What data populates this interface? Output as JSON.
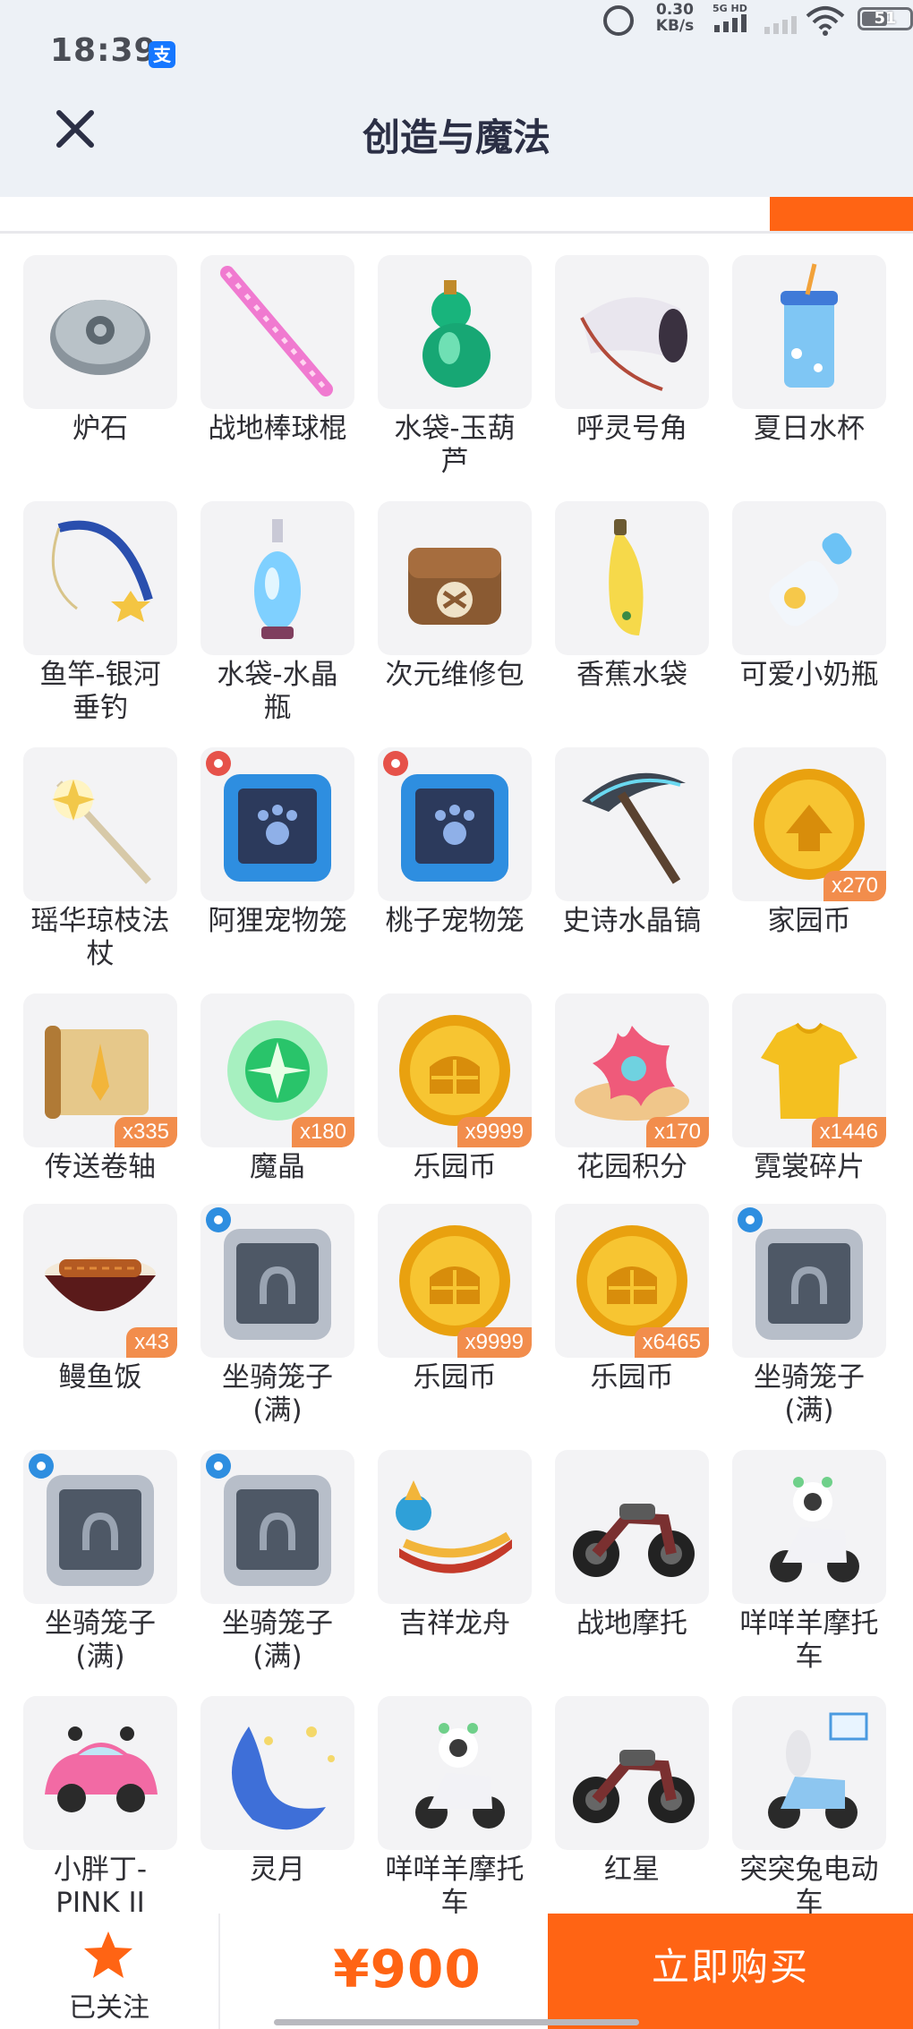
{
  "status_bar": {
    "time": "18:39",
    "app_badge": "支",
    "net_speed_value": "0.30",
    "net_speed_unit": "KB/s",
    "network_label": "5G HD",
    "battery": "51"
  },
  "header": {
    "title": "创造与魔法"
  },
  "items": [
    {
      "name": "炉石",
      "icon": "hearthstone-icon"
    },
    {
      "name": "战地棒球棍",
      "icon": "baseball-bat-icon"
    },
    {
      "name": "水袋-玉葫芦",
      "icon": "jade-gourd-icon"
    },
    {
      "name": "呼灵号角",
      "icon": "horn-icon"
    },
    {
      "name": "夏日水杯",
      "icon": "summer-cup-icon"
    },
    {
      "name": "鱼竿-银河垂钓",
      "icon": "fishing-rod-icon"
    },
    {
      "name": "水袋-水晶瓶",
      "icon": "crystal-bottle-icon"
    },
    {
      "name": "次元维修包",
      "icon": "repair-bag-icon"
    },
    {
      "name": "香蕉水袋",
      "icon": "banana-bag-icon"
    },
    {
      "name": "可爱小奶瓶",
      "icon": "milk-bottle-icon"
    },
    {
      "name": "瑶华琼枝法杖",
      "icon": "magic-staff-icon"
    },
    {
      "name": "阿狸宠物笼",
      "icon": "pet-cage-icon"
    },
    {
      "name": "桃子宠物笼",
      "icon": "pet-cage-icon"
    },
    {
      "name": "史诗水晶镐",
      "icon": "pickaxe-icon"
    },
    {
      "name": "家园币",
      "icon": "home-coin-icon",
      "qty": "x270"
    },
    {
      "name": "传送卷轴",
      "icon": "teleport-scroll-icon",
      "qty": "x335"
    },
    {
      "name": "魔晶",
      "icon": "magic-crystal-icon",
      "qty": "x180"
    },
    {
      "name": "乐园币",
      "icon": "park-coin-icon",
      "qty": "x9999"
    },
    {
      "name": "花园积分",
      "icon": "flower-points-icon",
      "qty": "x170"
    },
    {
      "name": "霓裳碎片",
      "icon": "shirt-fragment-icon",
      "qty": "x1446"
    },
    {
      "name": "鳗鱼饭",
      "icon": "eel-rice-icon",
      "qty": "x43"
    },
    {
      "name": "坐骑笼子(满)",
      "icon": "mount-cage-icon"
    },
    {
      "name": "乐园币",
      "icon": "park-coin-icon",
      "qty": "x9999"
    },
    {
      "name": "乐园币",
      "icon": "park-coin-icon",
      "qty": "x6465"
    },
    {
      "name": "坐骑笼子(满)",
      "icon": "mount-cage-icon"
    },
    {
      "name": "坐骑笼子(满)",
      "icon": "mount-cage-icon"
    },
    {
      "name": "坐骑笼子(满)",
      "icon": "mount-cage-icon"
    },
    {
      "name": "吉祥龙舟",
      "icon": "dragon-boat-icon"
    },
    {
      "name": "战地摩托",
      "icon": "motorcycle-icon"
    },
    {
      "name": "咩咩羊摩托车",
      "icon": "sheep-scooter-icon"
    },
    {
      "name": "小胖丁-PINK II",
      "icon": "pink-car-icon"
    },
    {
      "name": "灵月",
      "icon": "moon-icon"
    },
    {
      "name": "咩咩羊摩托车",
      "icon": "sheep-scooter-icon"
    },
    {
      "name": "红星",
      "icon": "motorcycle-icon"
    },
    {
      "name": "突突兔电动车",
      "icon": "rabbit-scooter-icon"
    }
  ],
  "name_lines": [
    [
      "炉石"
    ],
    [
      "战地棒球棍"
    ],
    [
      "水袋-玉葫",
      "芦"
    ],
    [
      "呼灵号角"
    ],
    [
      "夏日水杯"
    ],
    [
      "鱼竿-银河",
      "垂钓"
    ],
    [
      "水袋-水晶",
      "瓶"
    ],
    [
      "次元维修包"
    ],
    [
      "香蕉水袋"
    ],
    [
      "可爱小奶瓶"
    ],
    [
      "瑶华琼枝法",
      "杖"
    ],
    [
      "阿狸宠物笼"
    ],
    [
      "桃子宠物笼"
    ],
    [
      "史诗水晶镐"
    ],
    [
      "家园币"
    ],
    [
      "传送卷轴"
    ],
    [
      "魔晶"
    ],
    [
      "乐园币"
    ],
    [
      "花园积分"
    ],
    [
      "霓裳碎片"
    ],
    [
      "鳗鱼饭"
    ],
    [
      "坐骑笼子",
      "(满)"
    ],
    [
      "乐园币"
    ],
    [
      "乐园币"
    ],
    [
      "坐骑笼子",
      "(满)"
    ],
    [
      "坐骑笼子",
      "(满)"
    ],
    [
      "坐骑笼子",
      "(满)"
    ],
    [
      "吉祥龙舟"
    ],
    [
      "战地摩托"
    ],
    [
      "咩咩羊摩托",
      "车"
    ],
    [
      "小胖丁-",
      "PINK II"
    ],
    [
      "灵月"
    ],
    [
      "咩咩羊摩托",
      "车"
    ],
    [
      "红星"
    ],
    [
      "突突兔电动",
      "车"
    ]
  ],
  "bottom_bar": {
    "follow_label": "已关注",
    "price": "¥900",
    "buy_label": "立即购买"
  },
  "colors": {
    "accent": "#ff6414",
    "qty_badge": "#f28d4c",
    "header_bg": "#edf1f6",
    "title": "#2b2f45"
  }
}
